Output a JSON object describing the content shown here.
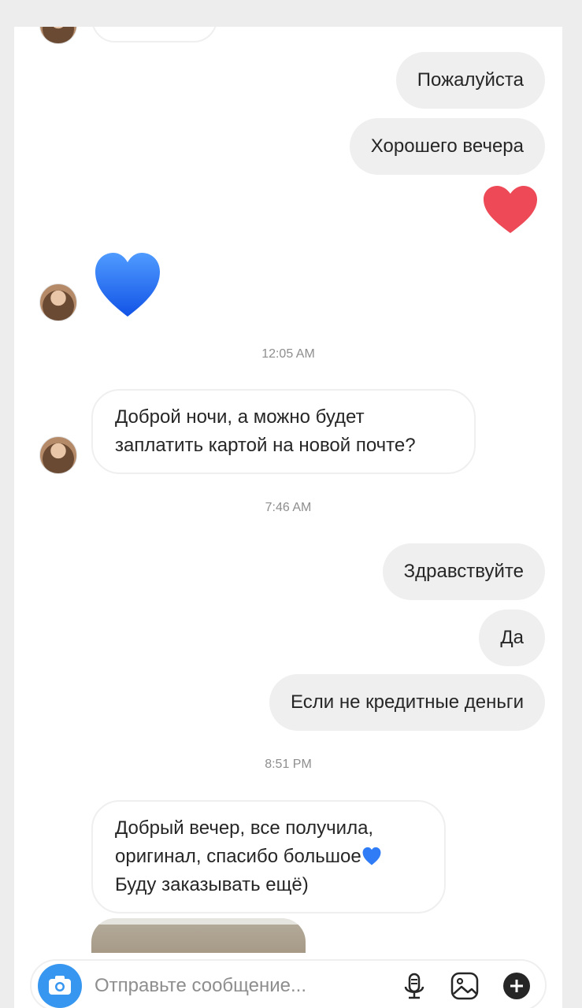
{
  "messages": {
    "out_1": "Пожалуйста",
    "out_2": "Хорошего вечера",
    "in_1": "Доброй ночи, а можно будет заплатить картой на новой почте?",
    "out_3": "Здравствуйте",
    "out_4": "Да",
    "out_5": "Если не кредитные деньги",
    "in_2_line1": "Добрый вечер, все получила,",
    "in_2_line2": "оригинал, спасибо большое",
    "in_2_line3": "Буду заказывать ещё)"
  },
  "timestamps": {
    "t1": "12:05 AM",
    "t2": "7:46 AM",
    "t3": "8:51 PM"
  },
  "reactions": {
    "red_heart_color": "#ed4956",
    "blue_heart_color": "#1a6ff2"
  },
  "composer": {
    "placeholder": "Отправьте сообщение...",
    "icons": [
      "camera-icon",
      "microphone-icon",
      "gallery-icon",
      "plus-icon"
    ],
    "accent_color": "#3797f0"
  }
}
